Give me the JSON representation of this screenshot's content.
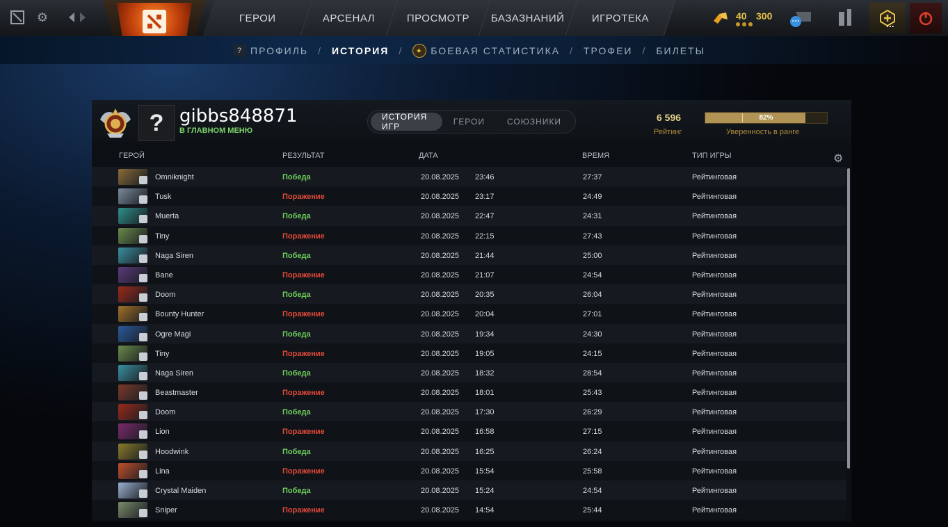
{
  "topbar": {
    "nav": [
      "ГЕРОИ",
      "АРСЕНАЛ",
      "ПРОСМОТР",
      "БАЗАЗНАНИЙ",
      "ИГРОТЕКА"
    ],
    "currency": [
      "40",
      "300"
    ],
    "chat_badge": "…",
    "plus_badge": "…"
  },
  "subnav": {
    "items": [
      "ПРОФИЛЬ",
      "ИСТОРИЯ",
      "БОЕВАЯ СТАТИСТИКА",
      "ТРОФЕИ",
      "БИЛЕТЫ"
    ],
    "active": "ИСТОРИЯ",
    "profile_badge": "?"
  },
  "profile": {
    "avatar": "?",
    "username": "gibbs848871",
    "status": "В ГЛАВНОМ МЕНЮ",
    "tabs": [
      "ИСТОРИЯ ИГР",
      "ГЕРОИ",
      "СОЮЗНИКИ"
    ],
    "rating_value": "6 596",
    "rating_label": "Рейтинг",
    "confidence_percent": 82,
    "confidence_text": "82%",
    "confidence_label": "Уверенность в ранге"
  },
  "table": {
    "headers": {
      "hero": "ГЕРОЙ",
      "result": "РЕЗУЛЬТАТ",
      "date": "ДАТА",
      "duration": "ВРЕМЯ",
      "type": "ТИП ИГРЫ"
    },
    "rows": [
      {
        "hero": "Omniknight",
        "result": "Победа",
        "win": true,
        "date": "20.08.2025",
        "time": "23:46",
        "duration": "27:37",
        "type": "Рейтинговая",
        "color": "#8a6a3a"
      },
      {
        "hero": "Tusk",
        "result": "Поражение",
        "win": false,
        "date": "20.08.2025",
        "time": "23:17",
        "duration": "24:49",
        "type": "Рейтинговая",
        "color": "#7a8a9a"
      },
      {
        "hero": "Muerta",
        "result": "Победа",
        "win": true,
        "date": "20.08.2025",
        "time": "22:47",
        "duration": "24:31",
        "type": "Рейтинговая",
        "color": "#2f8f8a"
      },
      {
        "hero": "Tiny",
        "result": "Поражение",
        "win": false,
        "date": "20.08.2025",
        "time": "22:15",
        "duration": "27:43",
        "type": "Рейтинговая",
        "color": "#6a8a4a"
      },
      {
        "hero": "Naga Siren",
        "result": "Победа",
        "win": true,
        "date": "20.08.2025",
        "time": "21:44",
        "duration": "25:00",
        "type": "Рейтинговая",
        "color": "#3a8fa0"
      },
      {
        "hero": "Bane",
        "result": "Поражение",
        "win": false,
        "date": "20.08.2025",
        "time": "21:07",
        "duration": "24:54",
        "type": "Рейтинговая",
        "color": "#5a3a7a"
      },
      {
        "hero": "Doom",
        "result": "Победа",
        "win": true,
        "date": "20.08.2025",
        "time": "20:35",
        "duration": "26:04",
        "type": "Рейтинговая",
        "color": "#9a2a1a"
      },
      {
        "hero": "Bounty Hunter",
        "result": "Поражение",
        "win": false,
        "date": "20.08.2025",
        "time": "20:04",
        "duration": "27:01",
        "type": "Рейтинговая",
        "color": "#a0702a"
      },
      {
        "hero": "Ogre Magi",
        "result": "Победа",
        "win": true,
        "date": "20.08.2025",
        "time": "19:34",
        "duration": "24:30",
        "type": "Рейтинговая",
        "color": "#2a5a9a"
      },
      {
        "hero": "Tiny",
        "result": "Поражение",
        "win": false,
        "date": "20.08.2025",
        "time": "19:05",
        "duration": "24:15",
        "type": "Рейтинговая",
        "color": "#6a8a4a"
      },
      {
        "hero": "Naga Siren",
        "result": "Победа",
        "win": true,
        "date": "20.08.2025",
        "time": "18:32",
        "duration": "28:54",
        "type": "Рейтинговая",
        "color": "#3a8fa0"
      },
      {
        "hero": "Beastmaster",
        "result": "Поражение",
        "win": false,
        "date": "20.08.2025",
        "time": "18:01",
        "duration": "25:43",
        "type": "Рейтинговая",
        "color": "#7a3a2a"
      },
      {
        "hero": "Doom",
        "result": "Победа",
        "win": true,
        "date": "20.08.2025",
        "time": "17:30",
        "duration": "26:29",
        "type": "Рейтинговая",
        "color": "#9a2a1a"
      },
      {
        "hero": "Lion",
        "result": "Поражение",
        "win": false,
        "date": "20.08.2025",
        "time": "16:58",
        "duration": "27:15",
        "type": "Рейтинговая",
        "color": "#7a2a6a"
      },
      {
        "hero": "Hoodwink",
        "result": "Победа",
        "win": true,
        "date": "20.08.2025",
        "time": "16:25",
        "duration": "26:24",
        "type": "Рейтинговая",
        "color": "#8a7a2a"
      },
      {
        "hero": "Lina",
        "result": "Поражение",
        "win": false,
        "date": "20.08.2025",
        "time": "15:54",
        "duration": "25:58",
        "type": "Рейтинговая",
        "color": "#c0502a"
      },
      {
        "hero": "Crystal Maiden",
        "result": "Победа",
        "win": true,
        "date": "20.08.2025",
        "time": "15:24",
        "duration": "24:54",
        "type": "Рейтинговая",
        "color": "#9ab0d0"
      },
      {
        "hero": "Sniper",
        "result": "Поражение",
        "win": false,
        "date": "20.08.2025",
        "time": "14:54",
        "duration": "25:44",
        "type": "Рейтинговая",
        "color": "#7a8a6a"
      }
    ]
  },
  "colors": {
    "win": "#6fcf5b",
    "loss": "#e24a3b",
    "gold": "#e6c24a"
  }
}
